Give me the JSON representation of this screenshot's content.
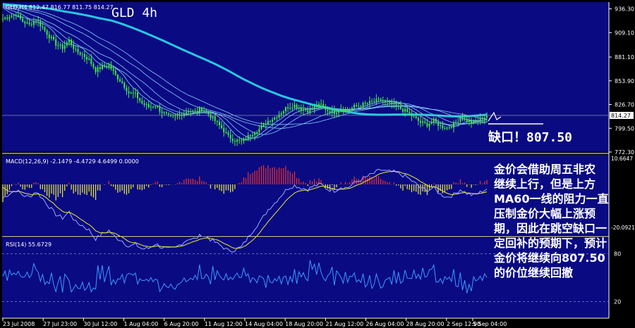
{
  "chart_data": [
    {
      "type": "candlestick",
      "header": "GLD,H4 812.47 816.77 811.75 814.27",
      "title": "GLD 4h",
      "y_ticks": [
        "936.30",
        "909.10",
        "881.10",
        "853.90",
        "826.70",
        "799.50",
        "772.30"
      ],
      "ylim": [
        772.3,
        944
      ],
      "last_price_label": "814.27",
      "gap_label": "缺口！807.50",
      "close_path": [
        925,
        928,
        930,
        922,
        918,
        924,
        915,
        905,
        896,
        892,
        900,
        888,
        884,
        878,
        866,
        870,
        872,
        860,
        852,
        840,
        838,
        828,
        824,
        826,
        818,
        813,
        812,
        816,
        820,
        818,
        822,
        816,
        808,
        800,
        790,
        786,
        784,
        790,
        796,
        800,
        808,
        812,
        818,
        824,
        826,
        822,
        820,
        824,
        826,
        820,
        818,
        822,
        820,
        824,
        826,
        828,
        830,
        832,
        828,
        826,
        822,
        818,
        812,
        806,
        804,
        808,
        802,
        800,
        804,
        812,
        808,
        806,
        810,
        814
      ]
    },
    {
      "type": "histogram+line",
      "header": "MACD(12,26,9) -2.1479 -4.4729 4.6499 0.0000",
      "y_ticks": [
        "10.6647",
        "-20.0921"
      ],
      "ylim": [
        -20.0921,
        10.6647
      ]
    },
    {
      "type": "line",
      "header": "RSI(14) 55.6729",
      "y_ticks": [
        "80",
        "20"
      ],
      "ylim": [
        0,
        100
      ]
    }
  ],
  "x_labels": [
    "23 Jul 2008",
    "27 Jul 23:00",
    "30 Jul 12:00",
    "1 Aug 04:00",
    "6 Aug 20:00",
    "11 Aug 12:00",
    "14 Aug 04:00",
    "18 Aug 20:00",
    "21 Aug 12:00",
    "26 Aug 04:00",
    "28 Aug 20:00",
    "2 Sep 12:00",
    "5 Sep 04:00"
  ],
  "annotation": [
    "金价会借助周五非农",
    "继续上行，但是上方",
    "MA60一线的阻力一直",
    "压制金价大幅上涨预",
    "期，因此在跳空缺口一",
    "定回补的预期下，预计",
    "金价将继续向807.50",
    "的价位继续回撤"
  ],
  "colors": {
    "bg": "#000000",
    "panel": "#0a0a82",
    "candle": "#44e844",
    "ma60": "#28c8e0",
    "ma": "#88ccff",
    "macd_pos": "#e03030",
    "macd_neg": "#e0e040",
    "rsi": "#3a9aff",
    "axis_text": "#ffffff"
  }
}
